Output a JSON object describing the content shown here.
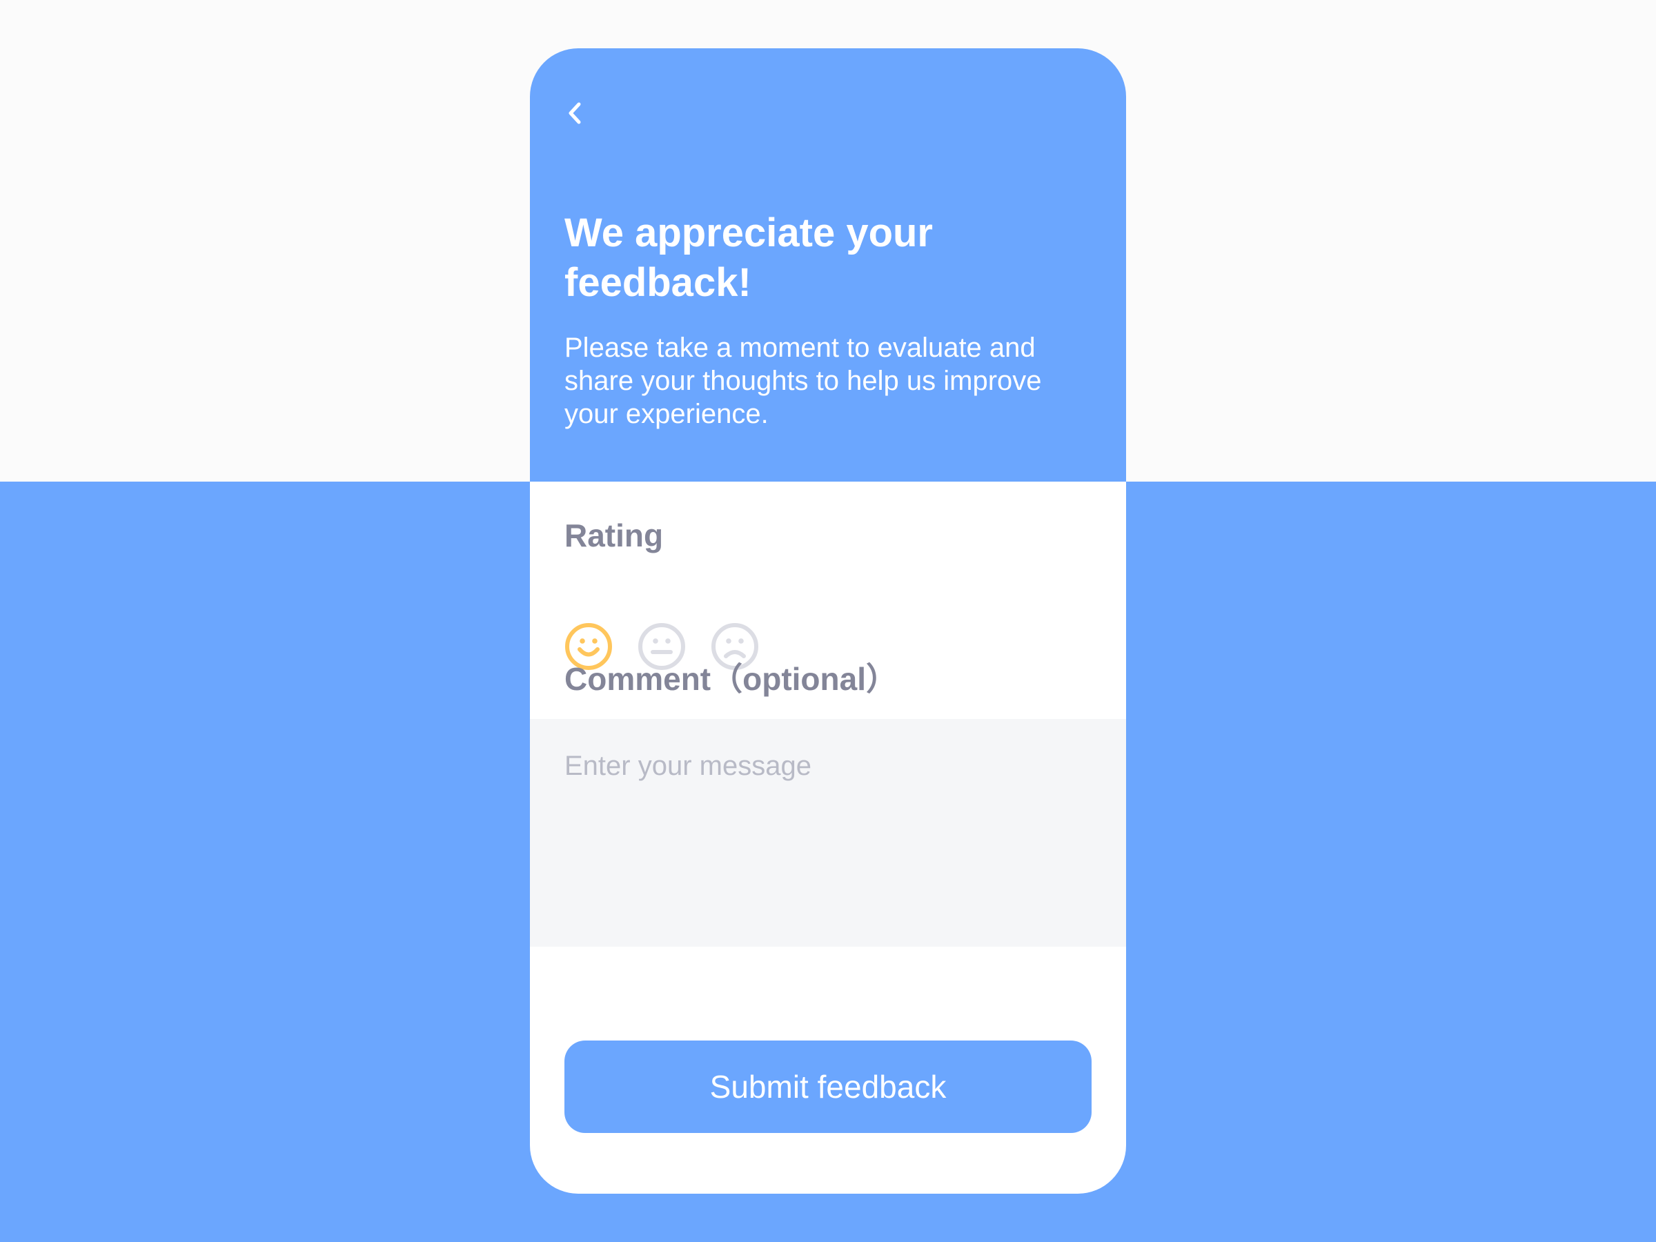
{
  "header": {
    "title": "We appreciate your feedback!",
    "subtitle": "Please take a moment to evaluate and share your thoughts to help us improve your experience.",
    "back_icon": "chevron-left-icon"
  },
  "rating": {
    "label": "Rating",
    "options": [
      {
        "icon": "smile-icon",
        "selected": true
      },
      {
        "icon": "neutral-face-icon",
        "selected": false
      },
      {
        "icon": "sad-face-icon",
        "selected": false
      }
    ]
  },
  "comment": {
    "label": "Comment（optional）",
    "placeholder": "Enter your message",
    "value": ""
  },
  "submit": {
    "label": "Submit feedback"
  },
  "colors": {
    "accent": "#6ba6fe",
    "selected_rating": "#ffc65c",
    "unselected_rating": "#dcdde4",
    "label_text": "#838598",
    "input_background": "#f5f6f8",
    "placeholder_text": "#b8bac6"
  }
}
